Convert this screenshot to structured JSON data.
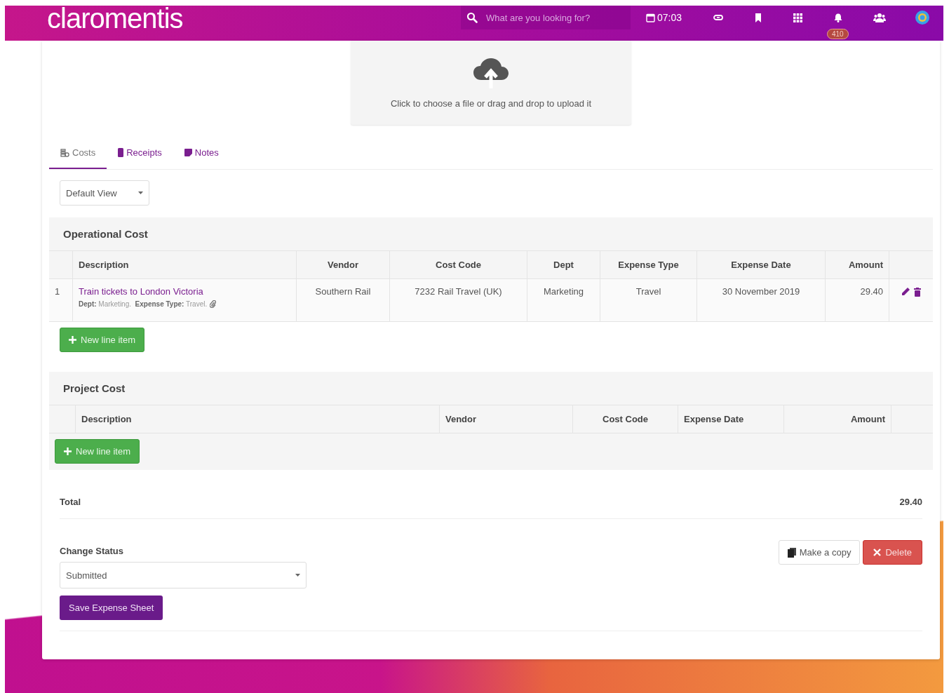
{
  "header": {
    "logo": "claromentis",
    "search": {
      "placeholder": "What are you looking for?"
    },
    "time": "07:03",
    "notifications": "410"
  },
  "upload": {
    "text": "Click to choose a file or drag and drop to upload it"
  },
  "tabs": [
    {
      "label": "Costs",
      "selected": true
    },
    {
      "label": "Receipts",
      "selected": false
    },
    {
      "label": "Notes",
      "selected": false
    }
  ],
  "view_select": {
    "value": "Default View"
  },
  "operational_cost": {
    "title": "Operational Cost",
    "columns": [
      "Description",
      "Vendor",
      "Cost Code",
      "Dept",
      "Expense Type",
      "Expense Date",
      "Amount"
    ],
    "rows": [
      {
        "number": "1",
        "description": "Train tickets to London Victoria",
        "details": "**Dept:** Marketing.  **Expense Type:** Travel.",
        "vendor": "Southern Rail",
        "cost_code": "7232 Rail Travel (UK)",
        "dept": "Marketing",
        "expense_type": "Travel",
        "expense_date": "30 November 2019",
        "amount": "29.40"
      }
    ],
    "new_button": "New line item"
  },
  "project_cost": {
    "title": "Project Cost",
    "columns": [
      "Description",
      "Vendor",
      "Cost Code",
      "Expense Date",
      "Amount"
    ],
    "new_button": "New line item"
  },
  "total": {
    "label": "Total",
    "value": "29.40"
  },
  "status": {
    "label": "Change Status",
    "value": "Submitted",
    "save_button": "Save Expense Sheet"
  },
  "actions": {
    "copy_button": "Make a copy",
    "delete_button": "Delete"
  }
}
